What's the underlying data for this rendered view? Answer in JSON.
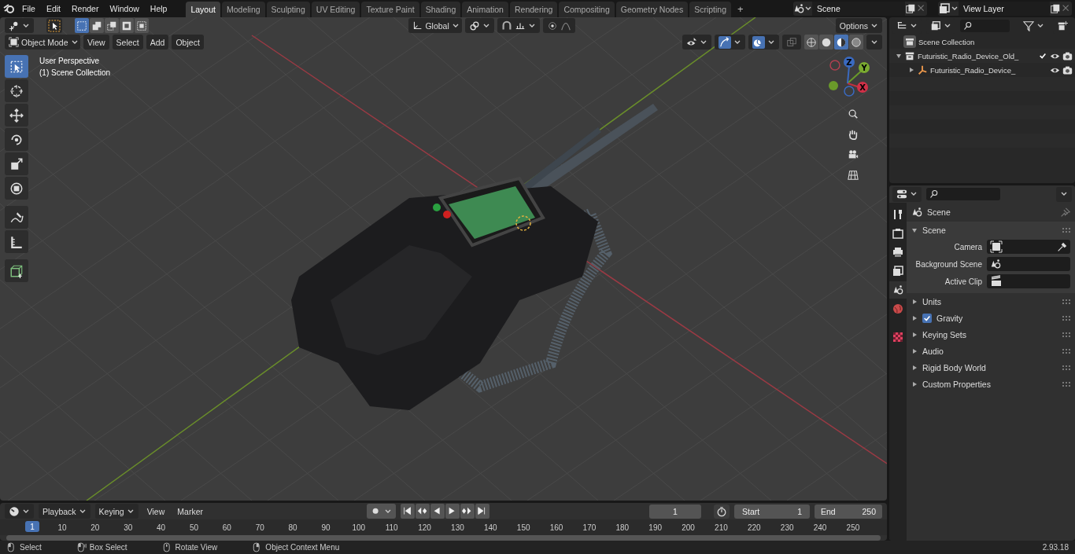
{
  "menu": [
    "File",
    "Edit",
    "Render",
    "Window",
    "Help"
  ],
  "workspaces": [
    {
      "label": "Layout",
      "selected": true
    },
    {
      "label": "Modeling",
      "selected": false
    },
    {
      "label": "Sculpting",
      "selected": false
    },
    {
      "label": "UV Editing",
      "selected": false
    },
    {
      "label": "Texture Paint",
      "selected": false
    },
    {
      "label": "Shading",
      "selected": false
    },
    {
      "label": "Animation",
      "selected": false
    },
    {
      "label": "Rendering",
      "selected": false
    },
    {
      "label": "Compositing",
      "selected": false
    },
    {
      "label": "Geometry Nodes",
      "selected": false
    },
    {
      "label": "Scripting",
      "selected": false
    }
  ],
  "add_workspace": "+",
  "scene_field": {
    "value": "Scene"
  },
  "view_layer_field": {
    "value": "View Layer"
  },
  "viewport": {
    "select_modes": [
      {
        "selected": true
      },
      {
        "selected": false
      },
      {
        "selected": false
      },
      {
        "selected": false
      },
      {
        "selected": false
      }
    ],
    "transform_orientation": "Global",
    "options": "Options",
    "mode": "Object Mode",
    "menus": [
      "View",
      "Select",
      "Add",
      "Object"
    ],
    "shading_modes": [
      {
        "selected": false
      },
      {
        "selected": false
      },
      {
        "selected": true
      },
      {
        "selected": false
      }
    ],
    "overlay_lines": [
      "User Perspective",
      "(1) Scene Collection"
    ],
    "gizmo_axes": [
      "Z",
      "Y",
      "X"
    ]
  },
  "outliner": {
    "root": "Scene Collection",
    "items": [
      {
        "label": "Futuristic_Radio_Device_Old_",
        "kind": "collection",
        "expanded": true,
        "checked": true,
        "children": [
          {
            "label": "Futuristic_Radio_Device_",
            "kind": "object",
            "expanded": false
          }
        ]
      }
    ]
  },
  "properties": {
    "tabs": [
      {
        "kind": "tool",
        "selected": false
      },
      {
        "kind": "render",
        "selected": false
      },
      {
        "kind": "output",
        "selected": false
      },
      {
        "kind": "view_layer",
        "selected": false
      },
      {
        "kind": "scene",
        "selected": true
      },
      {
        "kind": "world",
        "selected": false
      },
      {
        "kind": "texture",
        "selected": false
      }
    ],
    "context": "Scene",
    "panel": {
      "title": "Scene",
      "expanded": true,
      "fields": [
        {
          "label": "Camera",
          "kind": "camera"
        },
        {
          "label": "Background Scene",
          "kind": "scene"
        },
        {
          "label": "Active Clip",
          "kind": "clip"
        }
      ]
    },
    "sections": [
      {
        "label": "Units",
        "expanded": false
      },
      {
        "label": "Gravity",
        "expanded": false,
        "checked": true
      },
      {
        "label": "Keying Sets",
        "expanded": false
      },
      {
        "label": "Audio",
        "expanded": false
      },
      {
        "label": "Rigid Body World",
        "expanded": false
      },
      {
        "label": "Custom Properties",
        "expanded": false
      }
    ]
  },
  "timeline": {
    "menus": [
      "Playback",
      "Keying",
      "View",
      "Marker"
    ],
    "current_frame": "1",
    "start_label": "Start",
    "start": "1",
    "end_label": "End",
    "end": "250",
    "playhead": "1",
    "ticks": [
      "10",
      "20",
      "30",
      "40",
      "50",
      "60",
      "70",
      "80",
      "90",
      "100",
      "110",
      "120",
      "130",
      "140",
      "150",
      "160",
      "170",
      "180",
      "190",
      "200",
      "210",
      "220",
      "230",
      "240",
      "250"
    ]
  },
  "status_bar": {
    "hints": [
      {
        "label": "Select",
        "kind": "left"
      },
      {
        "label": "Box Select",
        "kind": "drag"
      },
      {
        "label": "Rotate View",
        "kind": "middle"
      },
      {
        "label": "Object Context Menu",
        "kind": "right"
      }
    ],
    "version": "2.93.18"
  }
}
